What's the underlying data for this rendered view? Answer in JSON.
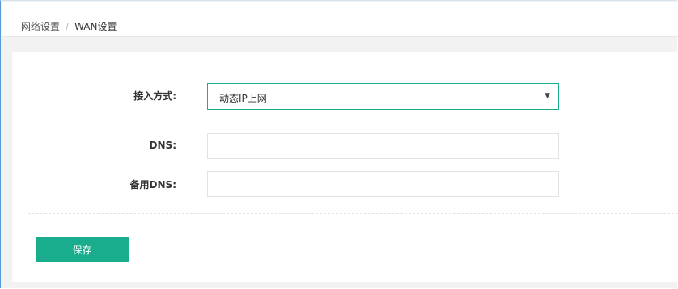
{
  "breadcrumb": {
    "items": [
      "网络设置",
      "WAN设置"
    ],
    "separator": "/"
  },
  "form": {
    "access_mode": {
      "label": "接入方式:",
      "value": "动态IP上网"
    },
    "dns": {
      "label": "DNS:",
      "value": "",
      "placeholder": ""
    },
    "backup_dns": {
      "label": "备用DNS:",
      "value": "",
      "placeholder": ""
    },
    "save_label": "保存"
  },
  "icons": {
    "select_caret": "▼"
  },
  "colors": {
    "accent": "#1aad8d",
    "background": "#f2f2f2",
    "panel": "#ffffff"
  }
}
